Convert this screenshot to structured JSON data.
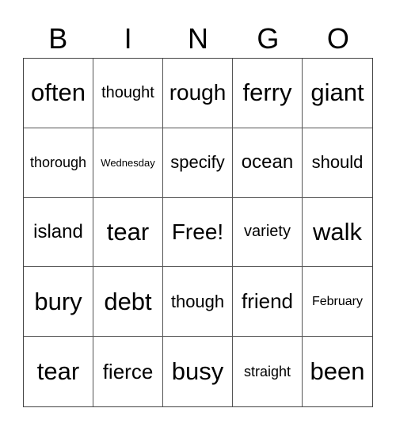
{
  "header": [
    "B",
    "I",
    "N",
    "G",
    "O"
  ],
  "cells": [
    [
      "often",
      "thought",
      "rough",
      "ferry",
      "giant"
    ],
    [
      "thorough",
      "Wednesday",
      "specify",
      "ocean",
      "should"
    ],
    [
      "island",
      "tear",
      "Free!",
      "variety",
      "walk"
    ],
    [
      "bury",
      "debt",
      "though",
      "friend",
      "February"
    ],
    [
      "tear",
      "fierce",
      "busy",
      "straight",
      "been"
    ]
  ]
}
